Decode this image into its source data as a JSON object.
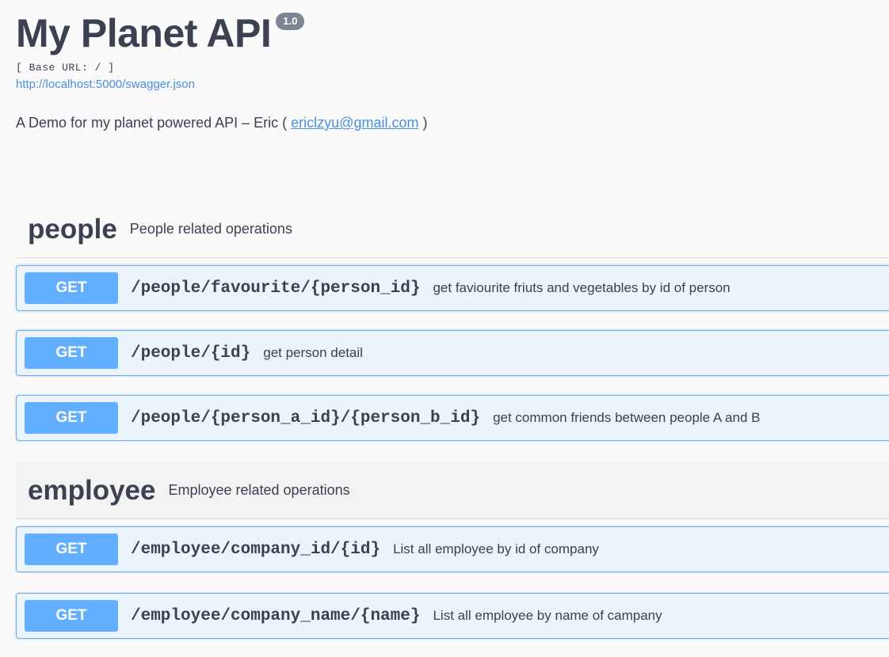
{
  "info": {
    "title": "My Planet API",
    "version": "1.0",
    "base_url": "[ Base URL: / ]",
    "spec_link": "http://localhost:5000/swagger.json",
    "description_text": "A Demo for my planet powered API – Eric ( ",
    "contact_email": "ericlzyu@gmail.com",
    "description_end": " )"
  },
  "colors": {
    "get_accent": "#61affe",
    "get_bg": "#ebf3fb",
    "link": "#4990e2",
    "text": "#3b4151"
  },
  "tags": [
    {
      "name": "people",
      "description": "People related operations",
      "operations": [
        {
          "method": "GET",
          "path": "/people/favourite/{person_id}",
          "summary": "get faviourite friuts and vegetables by id of person"
        },
        {
          "method": "GET",
          "path": "/people/{id}",
          "summary": "get person detail"
        },
        {
          "method": "GET",
          "path": "/people/{person_a_id}/{person_b_id}",
          "summary": "get common friends between people A and B"
        }
      ]
    },
    {
      "name": "employee",
      "description": "Employee related operations",
      "operations": [
        {
          "method": "GET",
          "path": "/employee/company_id/{id}",
          "summary": "List all employee by id of company"
        },
        {
          "method": "GET",
          "path": "/employee/company_name/{name}",
          "summary": "List all employee by name of campany"
        }
      ]
    }
  ]
}
